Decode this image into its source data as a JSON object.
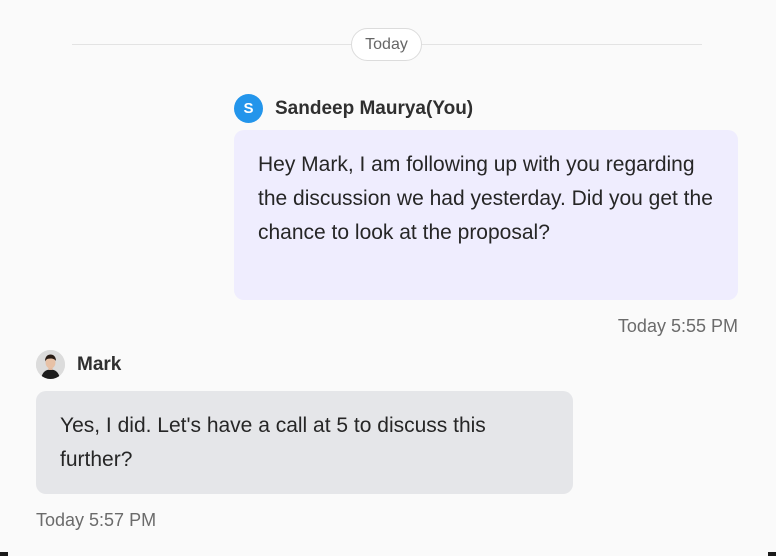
{
  "divider": {
    "label": "Today"
  },
  "messages": [
    {
      "sender": "Sandeep Maurya(You)",
      "avatar_initial": "S",
      "avatar_color": "#2395eb",
      "bubble_color": "#efedfe",
      "text": "Hey Mark, I am following up with you regarding the discussion we had yesterday. Did you get the chance to look at the proposal?",
      "timestamp": "Today 5:55 PM"
    },
    {
      "sender": "Mark",
      "avatar_icon": "user-photo-icon",
      "bubble_color": "#e5e6e9",
      "text": "Yes, I did. Let's have a call at 5 to discuss this further?",
      "timestamp": "Today 5:57 PM"
    }
  ]
}
